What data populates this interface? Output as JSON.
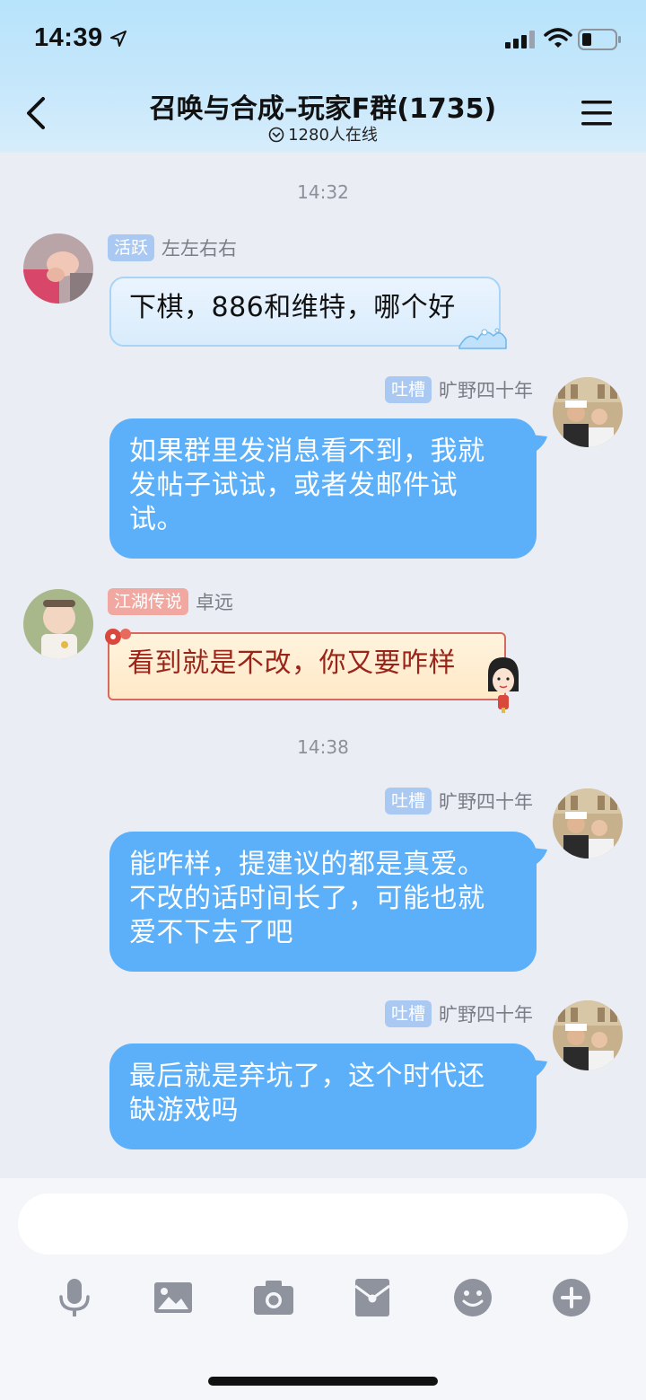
{
  "status_bar": {
    "time": "14:39"
  },
  "header": {
    "title": "召唤与合成–玩家F群(1735)",
    "online": "1280人在线"
  },
  "messages": [
    {
      "type": "timestamp",
      "text": "14:32"
    },
    {
      "side": "left",
      "badge": "活跃",
      "nick": "左左右右",
      "text": "下棋，886和维特，哪个好"
    },
    {
      "side": "right",
      "badge": "吐槽",
      "nick": "旷野四十年",
      "lines": [
        "如果群里发消息看不到，我就",
        "发帖子试试，或者发邮件试",
        "试。"
      ]
    },
    {
      "side": "left",
      "badge": "江湖传说",
      "nick": "卓远",
      "text": "看到就是不改，你又要咋样"
    },
    {
      "type": "timestamp",
      "text": "14:38"
    },
    {
      "side": "right",
      "badge": "吐槽",
      "nick": "旷野四十年",
      "lines": [
        "能咋样，提建议的都是真爱。",
        "不改的话时间长了，可能也就",
        "爱不下去了吧"
      ]
    },
    {
      "side": "right",
      "badge": "吐槽",
      "nick": "旷野四十年",
      "lines": [
        "最后就是弃坑了，这个时代还",
        "缺游戏吗"
      ]
    }
  ],
  "input": {
    "value": "",
    "placeholder": ""
  },
  "toolbar_icons": [
    "microphone-icon",
    "image-icon",
    "camera-icon",
    "red-packet-icon",
    "emoji-icon",
    "plus-icon"
  ],
  "colors": {
    "bubble_blue": "#5bb0f9",
    "badge_blue": "#a9c8f2",
    "badge_pink": "#f0a8a1",
    "scroll_text": "#9a2418",
    "background": "#ebedf5"
  }
}
